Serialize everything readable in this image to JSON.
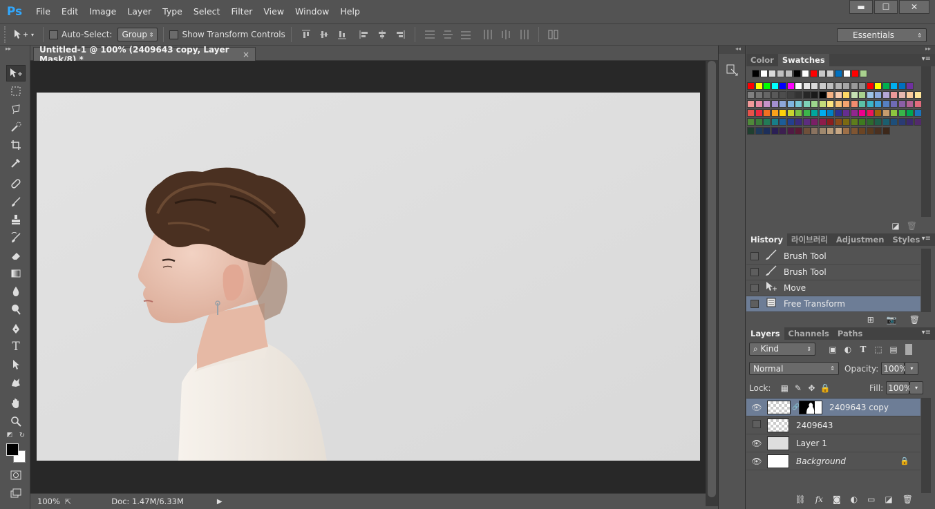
{
  "app": {
    "logo": "Ps",
    "menu": [
      "File",
      "Edit",
      "Image",
      "Layer",
      "Type",
      "Select",
      "Filter",
      "View",
      "Window",
      "Help"
    ],
    "window_controls": {
      "minimize": "▬",
      "maximize": "☐",
      "close": "✕"
    }
  },
  "options_bar": {
    "auto_select_label": "Auto-Select:",
    "auto_select_value": "Group",
    "show_transform_label": "Show Transform Controls",
    "workspace": "Essentials"
  },
  "document": {
    "tab_title": "Untitled-1 @ 100% (2409643 copy, Layer Mask/8) *",
    "tab_close": "×",
    "zoom": "100%",
    "doc_info": "Doc: 1.47M/6.33M"
  },
  "swatches_panel": {
    "tabs": [
      "Color",
      "Swatches"
    ],
    "active_tab": "Swatches",
    "colors": {
      "row0": [
        "#000000",
        "#ffffff",
        "#d9d9d9",
        "#c0c0c0",
        "#bfbfbf",
        "#000000",
        "#ffffff",
        "#ff0000",
        "#c8c8c8",
        "#d0d0d0",
        "#0070c0",
        "#ffffff",
        "#ff0000",
        "#a9d18e"
      ],
      "row1": [
        "#ff0000",
        "#ffff00",
        "#00ff00",
        "#00ffff",
        "#0000ff",
        "#ff00ff",
        "#ffffff",
        "#e6e6e6",
        "#d9d9d9",
        "#cccccc",
        "#bfbfbf",
        "#b3b3b3",
        "#a6a6a6",
        "#999999",
        "#8c8c8c",
        "#ff0000",
        "#ffff00",
        "#00b050",
        "#00b0f0",
        "#0070c0",
        "#7030a0"
      ],
      "row2": [
        "#808080",
        "#737373",
        "#666666",
        "#595959",
        "#4d4d4d",
        "#404040",
        "#333333",
        "#262626",
        "#1a1a1a",
        "#000000",
        "#f4b183",
        "#f8cbad",
        "#ffd966",
        "#c5e0b4",
        "#a9d18e",
        "#9dc3e6",
        "#8faadc",
        "#b4a7d6",
        "#ea9999",
        "#e6b8af",
        "#f9cb9c",
        "#ffe599"
      ],
      "row3": [
        "#f19999",
        "#e88aa5",
        "#c792c9",
        "#a38fd0",
        "#8ea7da",
        "#7fb4e0",
        "#79c8d6",
        "#7dd1b8",
        "#9dd58c",
        "#c4dd7b",
        "#fbe37f",
        "#f7c076",
        "#f4a46f",
        "#f28c6e",
        "#5bc2a7",
        "#3bb4c9",
        "#3f9fd8",
        "#5680c2",
        "#6f6bb4",
        "#8a5fa6",
        "#b16294",
        "#e06b7c"
      ],
      "row4": [
        "#e8534a",
        "#ee2a3e",
        "#f37021",
        "#f9a11b",
        "#fdd10a",
        "#c7d52f",
        "#7ac143",
        "#3cb54a",
        "#00a79d",
        "#00adef",
        "#0081c6",
        "#2e3192",
        "#662d91",
        "#92278f",
        "#ec008c",
        "#ed145b",
        "#a3620a",
        "#c69c6d",
        "#8dc63f",
        "#39b54a",
        "#00a651",
        "#1b75bc"
      ],
      "row5": [
        "#4f8a3a",
        "#3a7d3a",
        "#237a57",
        "#177e89",
        "#1c5d99",
        "#243f8f",
        "#3b2c7e",
        "#5c2d7e",
        "#7a1f66",
        "#8e1c4a",
        "#8b1e1e",
        "#8a4b1a",
        "#7b6a12",
        "#5e7d1c",
        "#3e7a1f",
        "#2d6a2d",
        "#1f5f4a",
        "#1b5e6e",
        "#1d4e7a",
        "#2a3b74",
        "#3d2a6e",
        "#522a6b"
      ],
      "row6": [
        "#1f3f2f",
        "#1f3a5a",
        "#1d2f5a",
        "#2a1f55",
        "#3c1f50",
        "#4f1a45",
        "#5a1a33",
        "#6e4f3a",
        "#8a7360",
        "#a0896e",
        "#b99c7a",
        "#c7a784",
        "#9e7048",
        "#7f5532",
        "#6b4423",
        "#5a3a1f",
        "#4a3020",
        "#3d281a"
      ]
    }
  },
  "history_panel": {
    "tabs": [
      "History",
      "라이브러리",
      "Adjustmen",
      "Styles"
    ],
    "active_tab": "History",
    "items": [
      {
        "label": "Brush Tool",
        "icon": "brush-icon",
        "selected": false
      },
      {
        "label": "Brush Tool",
        "icon": "brush-icon",
        "selected": false
      },
      {
        "label": "Move",
        "icon": "move-icon",
        "selected": false
      },
      {
        "label": "Free Transform",
        "icon": "document-icon",
        "selected": true
      }
    ]
  },
  "layers_panel": {
    "tabs": [
      "Layers",
      "Channels",
      "Paths"
    ],
    "active_tab": "Layers",
    "filter": "Kind",
    "blend_mode": "Normal",
    "opacity_label": "Opacity:",
    "opacity": "100%",
    "lock_label": "Lock:",
    "fill_label": "Fill:",
    "fill": "100%",
    "layers": [
      {
        "name": "2409643 copy",
        "visible": true,
        "selected": true,
        "mask": true
      },
      {
        "name": "2409643",
        "visible": false,
        "selected": false,
        "mask": false
      },
      {
        "name": "Layer 1",
        "visible": true,
        "selected": false,
        "mask": false
      },
      {
        "name": "Background",
        "visible": true,
        "selected": false,
        "mask": false,
        "locked": true
      }
    ]
  },
  "colors": {
    "ui_bg": "#535353",
    "canvas_bg": "#dedede",
    "selection": "#6d7d96",
    "ps_blue": "#31a8ff"
  }
}
